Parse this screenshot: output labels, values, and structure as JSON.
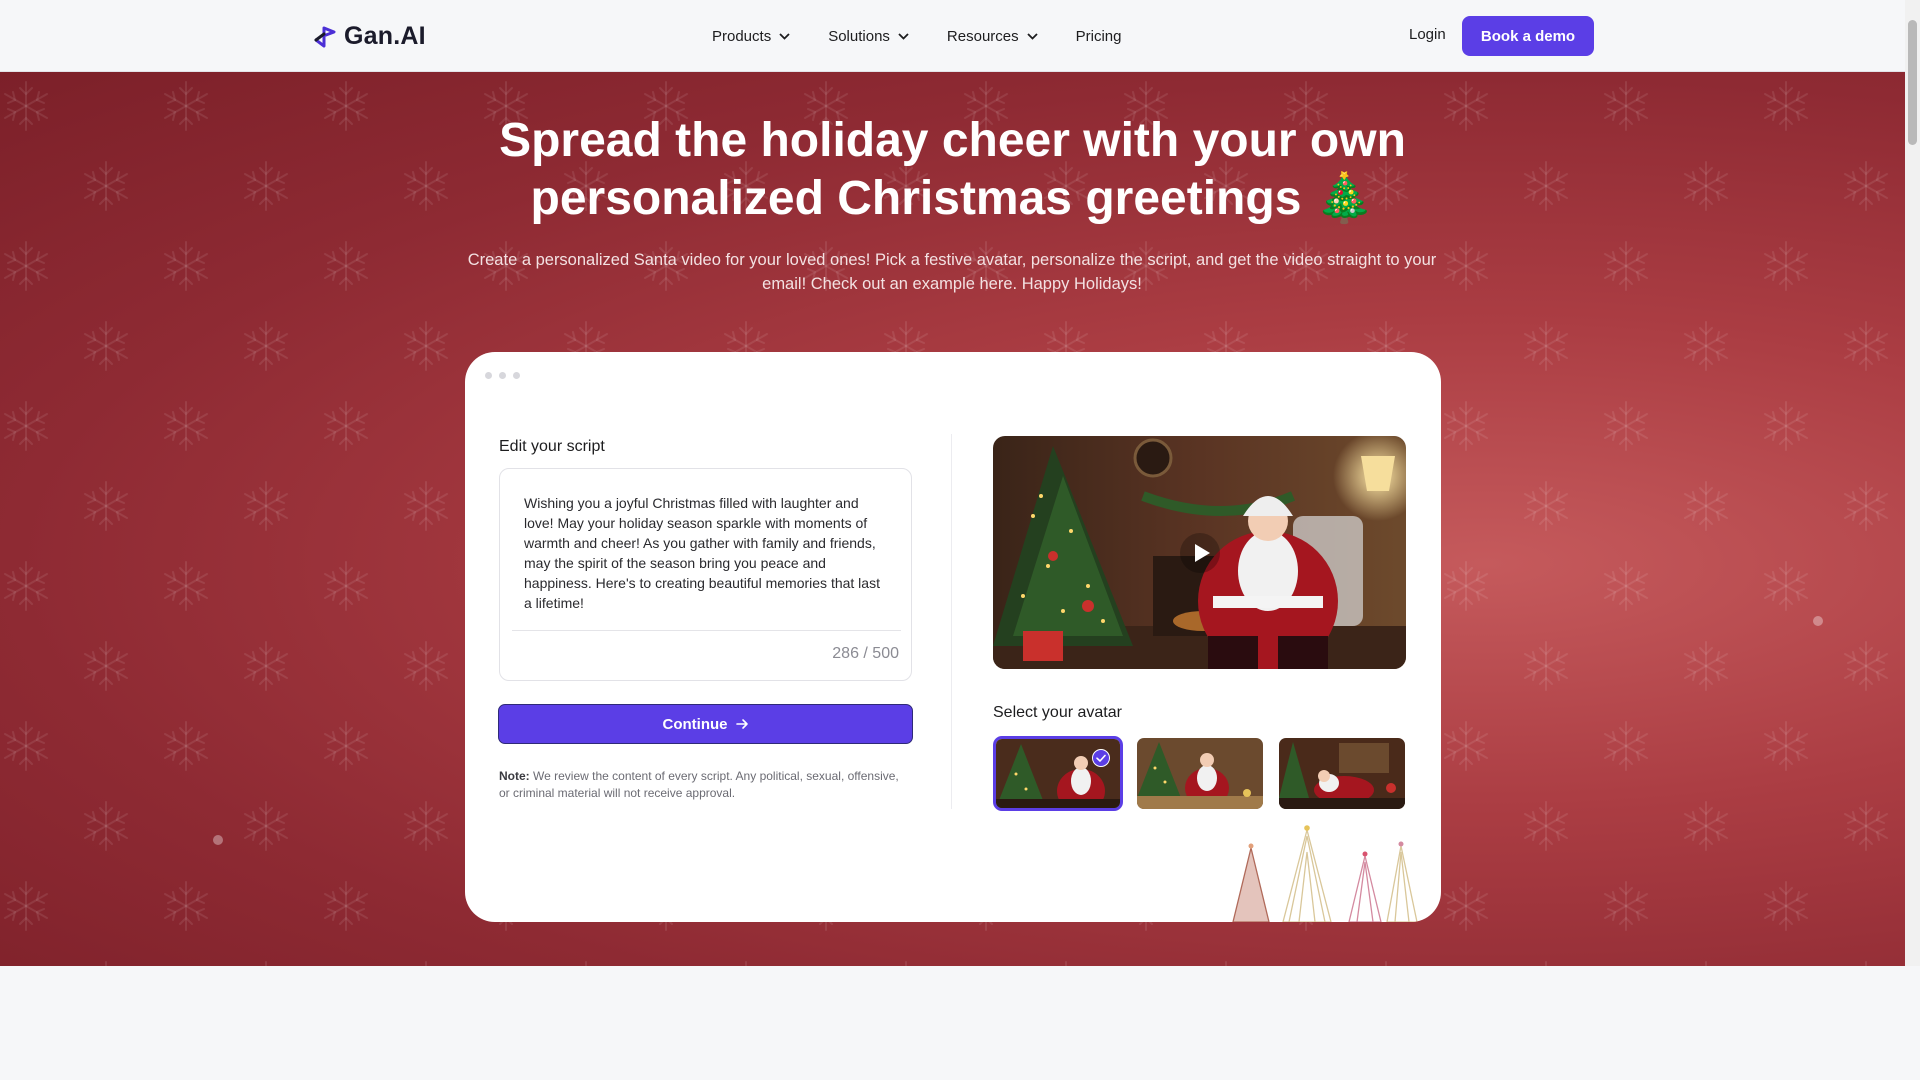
{
  "nav": {
    "brand": "Gan.AI",
    "items": [
      {
        "label": "Products",
        "dropdown": true
      },
      {
        "label": "Solutions",
        "dropdown": true
      },
      {
        "label": "Resources",
        "dropdown": true
      },
      {
        "label": "Pricing",
        "dropdown": false
      }
    ],
    "login": "Login",
    "cta": "Book a demo"
  },
  "hero": {
    "title_line1": "Spread the holiday cheer with your own",
    "title_line2": "personalized Christmas greetings 🎄",
    "subtitle": "Create a personalized Santa video for your loved ones! Pick a festive avatar, personalize the script, and get the video straight to your email! Check out an example here. Happy Holidays!"
  },
  "editor": {
    "label": "Edit your script",
    "script": "Wishing you a joyful Christmas filled with laughter and love! May your holiday season sparkle with moments of warmth and cheer! As you gather with family and friends, may the spirit of the season bring you peace and happiness. Here's to creating beautiful memories that last a lifetime!",
    "counter": "286 / 500",
    "continue": "Continue",
    "note_label": "Note:",
    "note_text": "We review the content of every script. Any political, sexual, offensive, or criminal material will not receive approval."
  },
  "preview": {
    "avatar_label": "Select your avatar",
    "selected_avatar": 0,
    "avatar_count": 3
  },
  "colors": {
    "accent": "#5b3ee6",
    "hero_bg": "#a3383f",
    "card_bg": "#ffffff"
  },
  "icons": [
    "logo-icon",
    "chevron-down-icon",
    "arrow-right-icon",
    "play-icon",
    "check-icon",
    "snowflake-icon",
    "christmas-tree-icon"
  ]
}
